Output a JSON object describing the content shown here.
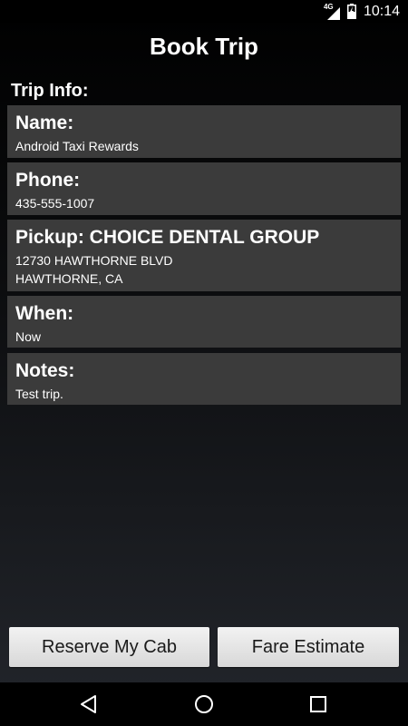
{
  "status_bar": {
    "network_type": "4G",
    "time": "10:14",
    "icons": [
      "signal-icon",
      "battery-icon"
    ]
  },
  "header": {
    "title": "Book Trip"
  },
  "trip_info": {
    "section_label": "Trip Info:",
    "name": {
      "label": "Name:",
      "value": "Android Taxi Rewards"
    },
    "phone": {
      "label": "Phone:",
      "value": "435-555-1007"
    },
    "pickup": {
      "label": "Pickup: CHOICE DENTAL GROUP",
      "address_line1": "12730 HAWTHORNE BLVD",
      "address_line2": "HAWTHORNE, CA"
    },
    "when": {
      "label": "When:",
      "value": "Now"
    },
    "notes": {
      "label": "Notes:",
      "value": "Test trip."
    }
  },
  "actions": {
    "reserve_label": "Reserve My Cab",
    "fare_label": "Fare Estimate"
  },
  "nav_bar": {
    "icons": [
      "back-icon",
      "home-icon",
      "recents-icon"
    ]
  },
  "colors": {
    "card_background": "#3b3b3b",
    "button_background": "#e6e6e6",
    "text": "#ffffff"
  }
}
